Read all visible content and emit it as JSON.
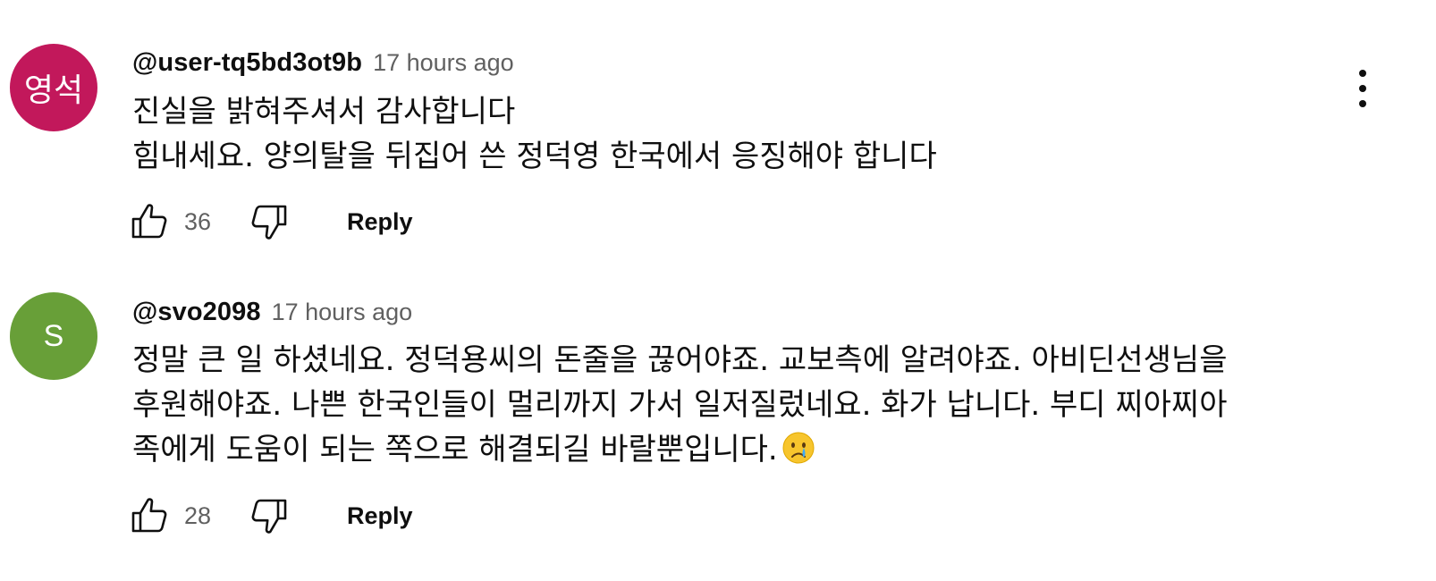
{
  "comments": [
    {
      "avatar_text": "영석",
      "avatar_color": "#c2185b",
      "author": "@user-tq5bd3ot9b",
      "time": "17 hours ago",
      "lines": [
        "진실을 밝혀주셔서 감사합니다",
        "힘내세요. 양의탈을 뒤집어 쓴 정덕영 한국에서 응징해야 합니다"
      ],
      "likes": "36",
      "reply_label": "Reply",
      "menu_icon": "more-vert-icon"
    },
    {
      "avatar_text": "S",
      "avatar_color": "#689f38",
      "author": "@svo2098",
      "time": "17 hours ago",
      "lines": [
        "정말 큰 일 하셨네요. 정덕용씨의 돈줄을 끊어야죠. 교보측에 알려야죠. 아비딘선생님을",
        "후원해야죠. 나쁜 한국인들이 멀리까지 가서 일저질렀네요. 화가 납니다. 부디 찌아찌아",
        "족에게 도움이 되는 쪽으로 해결되길 바랄뿐입니다."
      ],
      "trailing_emoji": "crying-face-emoji",
      "likes": "28",
      "reply_label": "Reply"
    }
  ],
  "icons": {
    "like": "thumb-up-icon",
    "dislike": "thumb-down-icon"
  },
  "colors": {
    "text_primary": "#0f0f0f",
    "text_secondary": "#606060"
  }
}
